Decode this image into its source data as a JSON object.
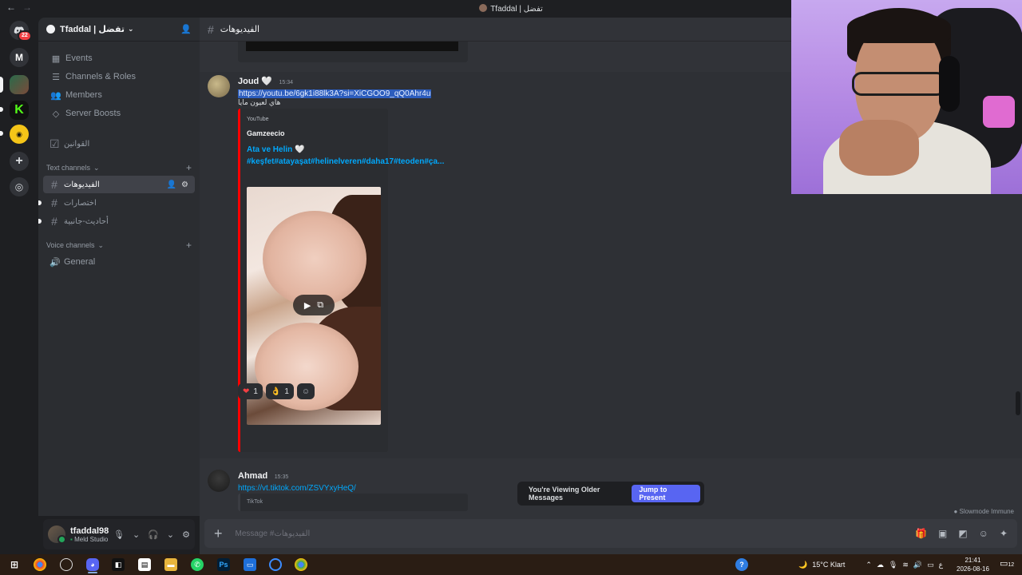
{
  "window": {
    "title": "Tfaddal | تفضل",
    "back": "←",
    "forward": "→"
  },
  "rail": {
    "home_badge": "22",
    "server_m": "M",
    "server_k": "K"
  },
  "guild": {
    "name": "Tfaddal | تفضل"
  },
  "sidebar": {
    "nav": [
      {
        "label": "Events"
      },
      {
        "label": "Channels & Roles"
      },
      {
        "label": "Members"
      },
      {
        "label": "Server Boosts"
      }
    ],
    "rules_channel": "القوانين",
    "text_category": "Text channels",
    "text_channels": [
      {
        "name": "الفيديوهات"
      },
      {
        "name": "اختصارات"
      },
      {
        "name": "أحاديث-جانبية"
      }
    ],
    "voice_category": "Voice channels",
    "voice_channels": [
      {
        "name": "General"
      }
    ]
  },
  "user": {
    "name": "tfaddal98",
    "status": "Meld Studio"
  },
  "chat": {
    "channel": "الفيديوهات",
    "messages": [
      {
        "author": "Joud 🤍",
        "time": "15:34",
        "link": "https://youtu.be/6gk1i88lk3A?si=XiCGOO9_qQ0Ahr4u",
        "text": "هاي لعيون مايا",
        "embed": {
          "provider": "YouTube",
          "author": "Gamzeecio",
          "title": "Ata ve Helin 🤍 #keşfet#atayaşat#helinelveren#daha17#teoden#ça..."
        },
        "reactions": [
          {
            "emoji": "❤",
            "count": "1"
          },
          {
            "emoji": "👌",
            "count": "1"
          }
        ]
      },
      {
        "author": "Ahmad",
        "time": "15:35",
        "link": "https://vt.tiktok.com/ZSVYxyHeQ/",
        "embed": {
          "provider": "TikTok"
        }
      }
    ],
    "older_notice": "You're Viewing Older Messages",
    "jump_label": "Jump to Present",
    "slowmode": "Slowmode Immune",
    "composer_placeholder": "Message #الفيديوهات"
  },
  "taskbar": {
    "weather": "15°C  Klart",
    "lang": "ع",
    "time": "21:41",
    "date": "2026-08-16",
    "notif_count": "12"
  },
  "colors": {
    "accent": "#5865f2",
    "link": "#00a8fc",
    "embed_youtube": "#ff0000",
    "online": "#23a55a"
  }
}
